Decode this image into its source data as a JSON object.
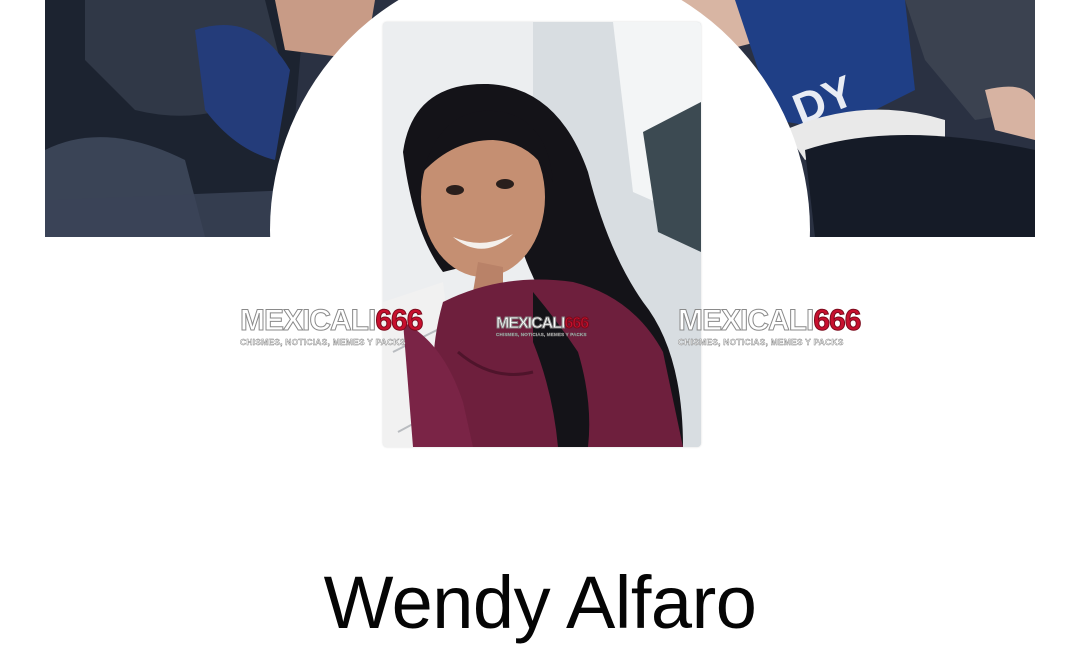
{
  "profile": {
    "name": "Wendy Alfaro"
  },
  "watermarks": {
    "left": {
      "brand_text": "MEXICALI",
      "brand_number": "666",
      "tagline": "CHISMES, NOTICIAS, MEMES Y PACKS"
    },
    "center": {
      "brand_text": "MEXICALI",
      "brand_number": "666",
      "tagline": "CHISMES, NOTICIAS, MEMES Y PACKS"
    },
    "right": {
      "brand_text": "MEXICALI",
      "brand_number": "666",
      "tagline": "CHISMES, NOTICIAS, MEMES Y PACKS"
    }
  },
  "colors": {
    "background": "#ffffff",
    "name_text": "#050505",
    "watermark_number": "#c8102e"
  }
}
